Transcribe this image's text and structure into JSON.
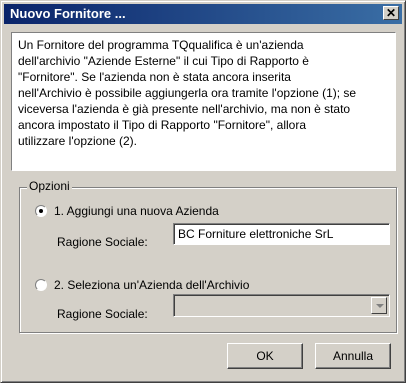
{
  "window": {
    "title": "Nuovo Fornitore ..."
  },
  "titlebar": {
    "close_label": "✕"
  },
  "info": {
    "lines": [
      "Un Fornitore del programma TQqualifica è un'azienda",
      "dell'archivio \"Aziende Esterne\" il cui Tipo di Rapporto è",
      "\"Fornitore\". Se l'azienda non è stata ancora inserita",
      "nell'Archivio è possibile aggiungerla ora tramite l'opzione (1); se",
      "viceversa l'azienda è già presente nell'archivio, ma non è stato",
      "ancora impostato il Tipo di Rapporto \"Fornitore\", allora",
      "utilizzare l'opzione (2)."
    ]
  },
  "options": {
    "group_label": "Opzioni",
    "option1": {
      "label": "1. Aggiungi una nuova Azienda",
      "selected": true
    },
    "option2": {
      "label": "2. Seleziona un'Azienda dell'Archivio",
      "selected": false
    },
    "field1": {
      "label": "Ragione Sociale:",
      "value": "BC Forniture elettroniche SrL"
    },
    "field2": {
      "label": "Ragione Sociale:",
      "value": ""
    }
  },
  "buttons": {
    "ok": "OK",
    "cancel": "Annulla"
  }
}
